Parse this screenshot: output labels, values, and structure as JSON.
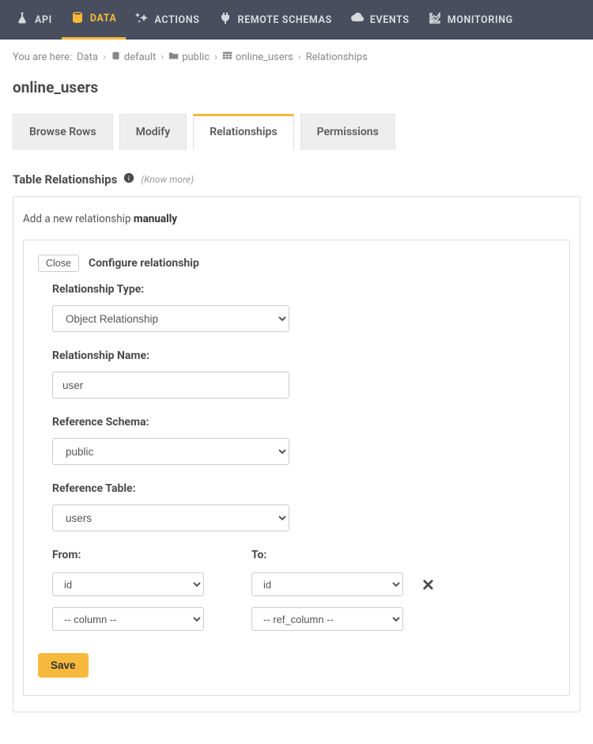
{
  "nav": {
    "items": [
      {
        "label": "API"
      },
      {
        "label": "DATA"
      },
      {
        "label": "ACTIONS"
      },
      {
        "label": "REMOTE SCHEMAS"
      },
      {
        "label": "EVENTS"
      },
      {
        "label": "MONITORING"
      }
    ]
  },
  "breadcrumb": {
    "lead": "You are here:",
    "items": [
      "Data",
      "default",
      "public",
      "online_users",
      "Relationships"
    ]
  },
  "page_title": "online_users",
  "tabs": [
    {
      "label": "Browse Rows"
    },
    {
      "label": "Modify"
    },
    {
      "label": "Relationships"
    },
    {
      "label": "Permissions"
    }
  ],
  "section": {
    "title": "Table Relationships",
    "know_more": "(Know more)"
  },
  "card": {
    "add_prefix": "Add a new relationship ",
    "add_suffix": "manually",
    "close": "Close",
    "configure": "Configure relationship",
    "form": {
      "rel_type_label": "Relationship Type:",
      "rel_type_value": "Object Relationship",
      "rel_name_label": "Relationship Name:",
      "rel_name_value": "user",
      "ref_schema_label": "Reference Schema:",
      "ref_schema_value": "public",
      "ref_table_label": "Reference Table:",
      "ref_table_value": "users",
      "from_label": "From:",
      "to_label": "To:",
      "from_values": [
        "id",
        "-- column --"
      ],
      "to_values": [
        "id",
        "-- ref_column --"
      ],
      "save": "Save"
    }
  }
}
